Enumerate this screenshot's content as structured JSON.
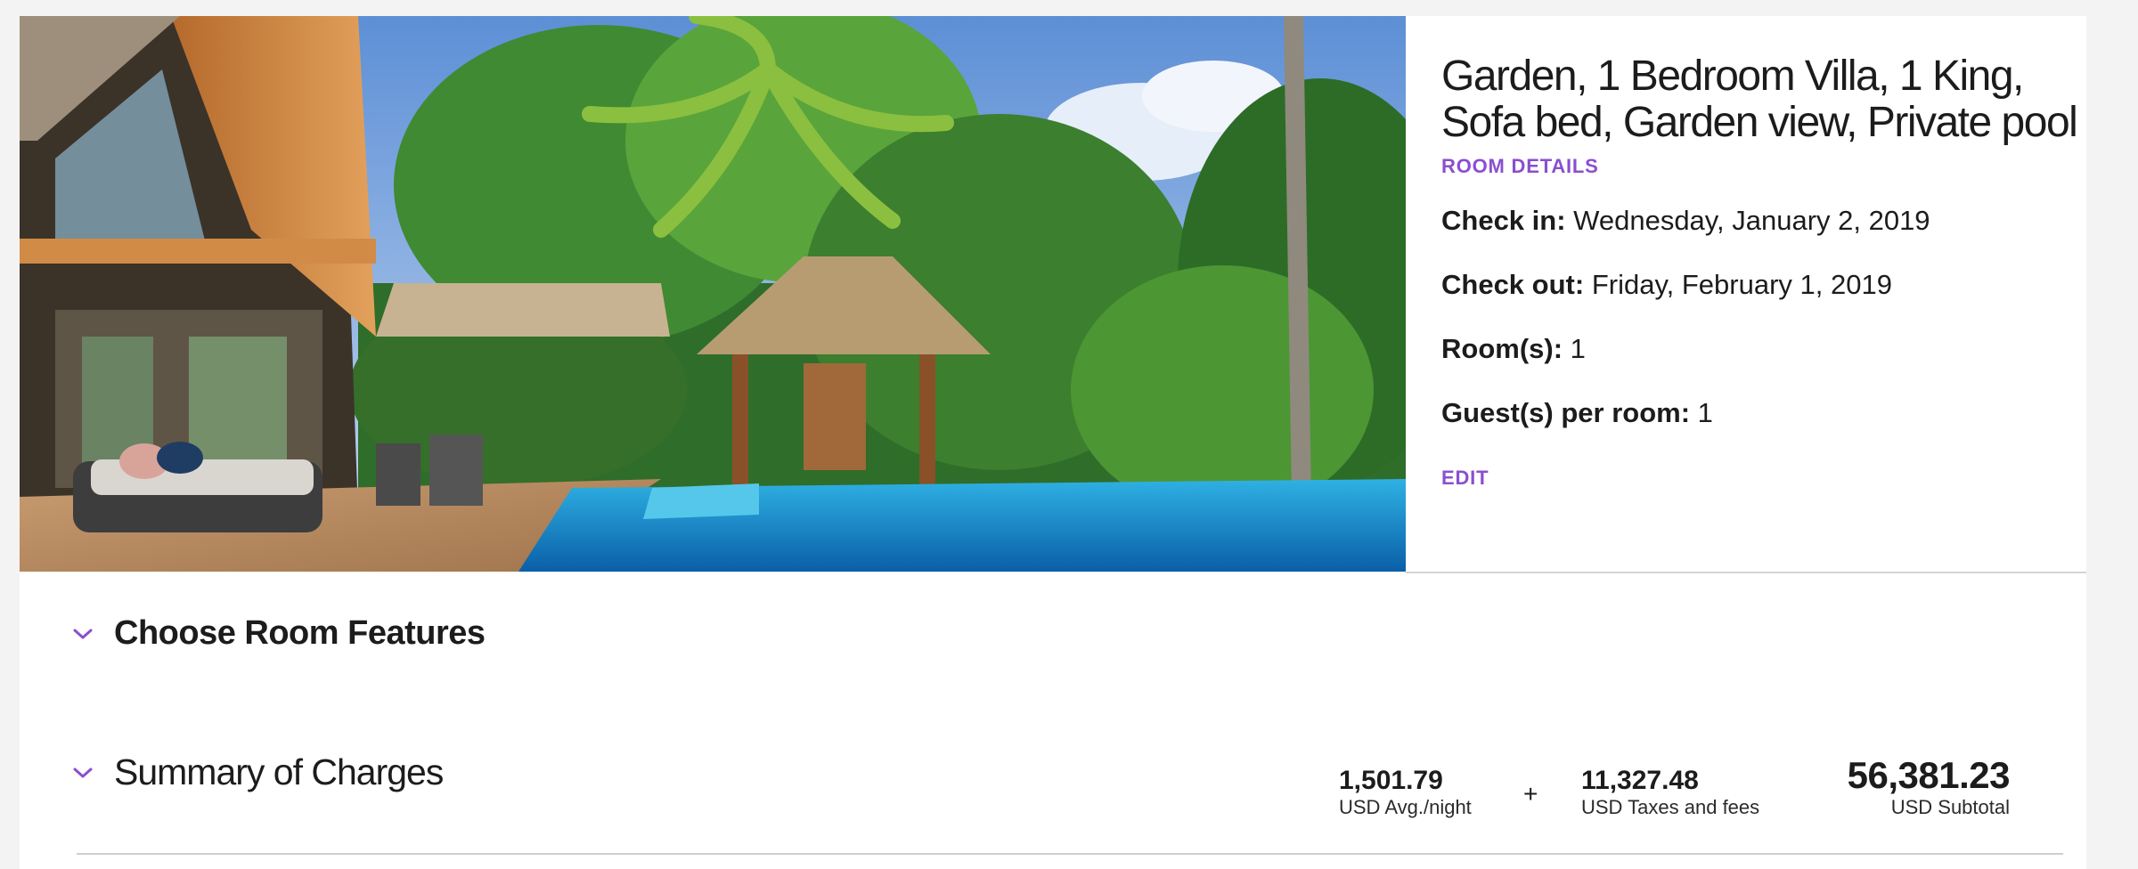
{
  "room": {
    "title": "Garden, 1 Bedroom Villa, 1 King, Sofa bed, Garden view, Private pool",
    "details_link": "ROOM DETAILS",
    "hero_image": "tropical-villa-pool-photo"
  },
  "stay": {
    "check_in_label": "Check in:",
    "check_in_value": "Wednesday, January 2, 2019",
    "check_out_label": "Check out:",
    "check_out_value": "Friday, February 1, 2019",
    "rooms_label": "Room(s):",
    "rooms_value": "1",
    "guests_label": "Guest(s) per room:",
    "guests_value": "1",
    "edit_link": "EDIT"
  },
  "sections": {
    "features_title": "Choose Room Features",
    "summary_title": "Summary of Charges",
    "chevron_icon": "chevron-down-icon"
  },
  "charges": {
    "avg_amount": "1,501.79",
    "avg_label": "USD Avg./night",
    "plus": "+",
    "tax_amount": "11,327.48",
    "tax_label": "USD Taxes and fees",
    "subtotal_amount": "56,381.23",
    "subtotal_label": "USD Subtotal"
  },
  "colors": {
    "accent": "#8a4fcf",
    "text": "#1c1c1c",
    "background": "#f3f3f3",
    "card": "#ffffff"
  }
}
